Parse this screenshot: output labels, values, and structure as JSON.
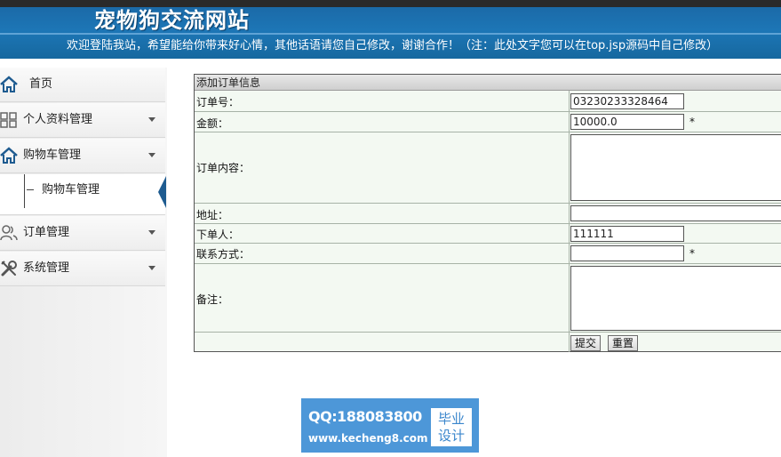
{
  "header": {
    "site_title": "宠物狗交流网站",
    "welcome": "欢迎登陆我站，希望能给你带来好心情，其他话语请您自己修改，谢谢合作！（注：此处文字您可以在top.jsp源码中自己修改）"
  },
  "sidebar": {
    "items": [
      {
        "label": "首页",
        "icon": "home-icon"
      },
      {
        "label": "个人资料管理",
        "icon": "grid-icon"
      },
      {
        "label": "购物车管理",
        "icon": "home-icon",
        "expanded": true,
        "children": [
          {
            "label": "购物车管理"
          }
        ]
      },
      {
        "label": "订单管理",
        "icon": "users-icon"
      },
      {
        "label": "系统管理",
        "icon": "tools-icon"
      }
    ]
  },
  "form": {
    "title": "添加订单信息",
    "fields": {
      "order_no": {
        "label": "订单号：",
        "value": "03230233328464"
      },
      "amount": {
        "label": "金额：",
        "value": "10000.0",
        "required_mark": "*"
      },
      "content": {
        "label": "订单内容：",
        "value": ""
      },
      "address": {
        "label": "地址：",
        "value": ""
      },
      "orderer": {
        "label": "下单人：",
        "value": "111111"
      },
      "contact": {
        "label": "联系方式：",
        "value": "",
        "required_mark": "*"
      },
      "remark": {
        "label": "备注：",
        "value": ""
      }
    },
    "submit_label": "提交",
    "reset_label": "重置"
  },
  "watermark": {
    "qq": "QQ:188083800",
    "url": "www.kecheng8.com",
    "badge_line1": "毕业",
    "badge_line2": "设计"
  },
  "colors": {
    "header_bg": "#1d76b6",
    "form_bg": "#f3f9f2",
    "active_marker": "#1e5b90",
    "watermark_bg": "#4d97d8"
  }
}
